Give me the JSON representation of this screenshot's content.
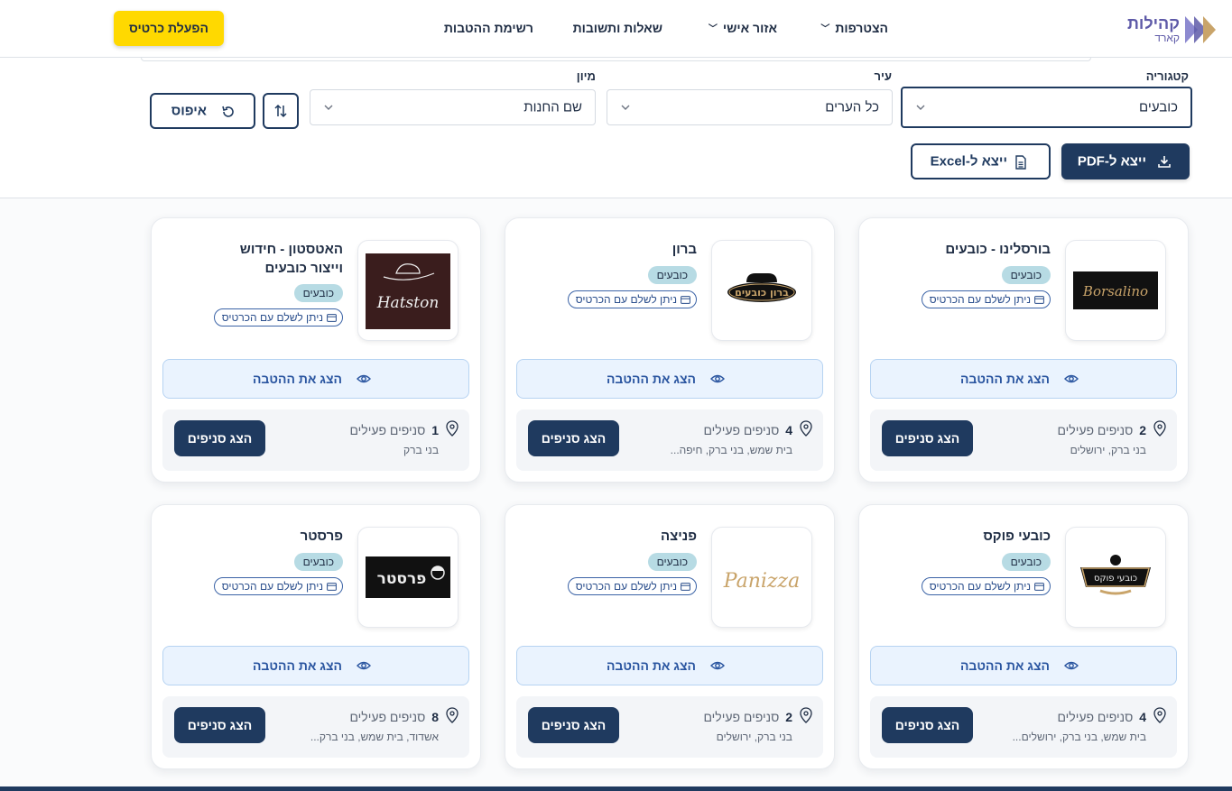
{
  "header": {
    "logo_name": "קהילות",
    "logo_sub": "קארד",
    "nav": [
      {
        "label": "הצטרפות",
        "has_dropdown": true
      },
      {
        "label": "אזור אישי",
        "has_dropdown": true
      },
      {
        "label": "שאלות ותשובות",
        "has_dropdown": false
      },
      {
        "label": "רשימת ההטבות",
        "has_dropdown": false
      }
    ],
    "activate_card": "הפעלת כרטיס"
  },
  "filters": {
    "category_label": "קטגוריה",
    "category_value": "כובעים",
    "city_label": "עיר",
    "city_value": "כל הערים",
    "sort_label": "מיון",
    "sort_value": "שם החנות",
    "reset_label": "איפוס",
    "export_pdf": "ייצא ל-PDF",
    "export_excel": "ייצא ל-Excel"
  },
  "card_labels": {
    "pay_with_card": "ניתן לשלם עם הכרטיס",
    "show_benefit": "הצג את ההטבה",
    "active_branches": "סניפים פעילים",
    "show_branches": "הצג סניפים"
  },
  "stores": [
    {
      "name": "בורסלינו - כובעים",
      "category": "כובעים",
      "branches": "2",
      "cities": "בני ברק, ירושלים",
      "logo": "borsalino-logo",
      "logo_text": "Borsalino"
    },
    {
      "name": "ברון",
      "category": "כובעים",
      "branches": "4",
      "cities": "בית שמש, בני ברק, חיפה...",
      "logo": "baron-logo",
      "logo_text": "ברון כובעים"
    },
    {
      "name": "האטסטון - חידוש וייצור כובעים",
      "category": "כובעים",
      "branches": "1",
      "cities": "בני ברק",
      "logo": "hatston-logo",
      "logo_text": "Hatston"
    },
    {
      "name": "כובעי פוקס",
      "category": "כובעים",
      "branches": "4",
      "cities": "בית שמש, בני ברק, ירושלים...",
      "logo": "fox-hats-logo",
      "logo_text": "כובעי פוקס"
    },
    {
      "name": "פניצה",
      "category": "כובעים",
      "branches": "2",
      "cities": "בני ברק, ירושלים",
      "logo": "panizza-logo",
      "logo_text": "Panizza"
    },
    {
      "name": "פרסטר",
      "category": "כובעים",
      "branches": "8",
      "cities": "אשדוד, בית שמש, בני ברק...",
      "logo": "forster-logo",
      "logo_text": "פרסטר"
    }
  ],
  "colors": {
    "primary": "#1f3a5f",
    "accent_yellow": "#ffd900",
    "badge_bg": "#b7dbe4",
    "benefit_bg": "#eaf3fe",
    "logo_purple": "#5e5aa8"
  }
}
